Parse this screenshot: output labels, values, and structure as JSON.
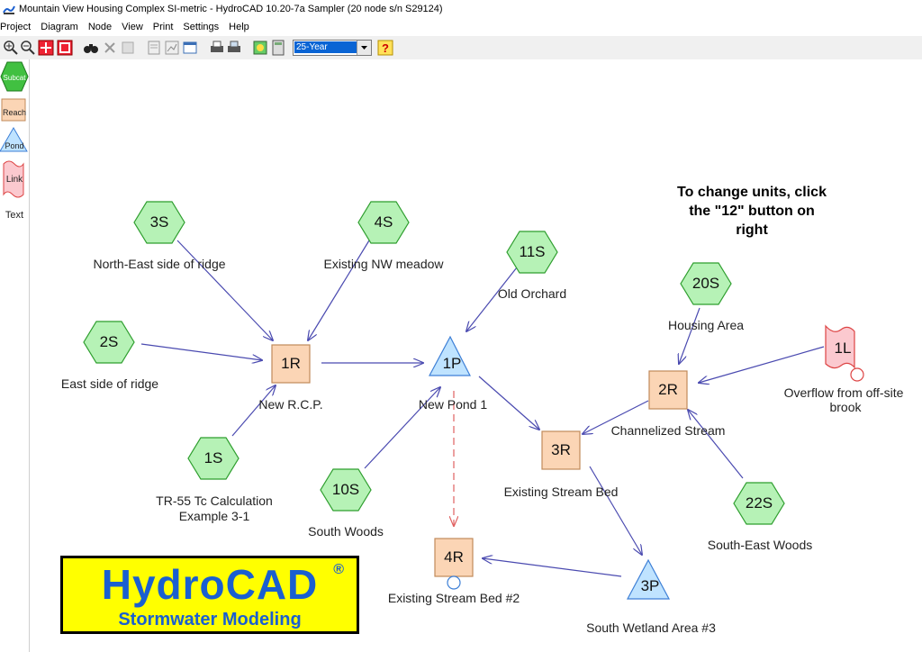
{
  "window": {
    "title": "Mountain View Housing Complex SI-metric - HydroCAD 10.20-7a Sampler (20 node s/n S29124)"
  },
  "menu": [
    "Project",
    "Diagram",
    "Node",
    "View",
    "Print",
    "Settings",
    "Help"
  ],
  "toolbar": {
    "storm_select": "25-Year",
    "help_button": "?"
  },
  "palette": {
    "subcat": "Subcat",
    "reach": "Reach",
    "pond": "Pond",
    "link": "Link",
    "text": "Text"
  },
  "nodes": {
    "n3S": {
      "id": "3S",
      "label": "North-East side of ridge"
    },
    "n4S": {
      "id": "4S",
      "label": "Existing NW meadow"
    },
    "n11S": {
      "id": "11S",
      "label": "Old Orchard"
    },
    "n20S": {
      "id": "20S",
      "label": "Housing Area"
    },
    "n2S": {
      "id": "2S",
      "label": "East side of ridge"
    },
    "n1R": {
      "id": "1R",
      "label": "New R.C.P."
    },
    "n1P": {
      "id": "1P",
      "label": "New Pond 1"
    },
    "n1L": {
      "id": "1L",
      "label_1": "Overflow from off-site",
      "label_2": "brook"
    },
    "n2R": {
      "id": "2R",
      "label": "Channelized Stream"
    },
    "n1S": {
      "id": "1S",
      "label_1": "TR-55 Tc Calculation",
      "label_2": "Example 3-1"
    },
    "n10S": {
      "id": "10S",
      "label": "South Woods"
    },
    "n3R": {
      "id": "3R",
      "label": "Existing Stream Bed"
    },
    "n22S": {
      "id": "22S",
      "label": "South-East Woods"
    },
    "n4R": {
      "id": "4R",
      "label": "Existing Stream Bed #2"
    },
    "n3P": {
      "id": "3P",
      "label": "South Wetland Area #3"
    }
  },
  "note": {
    "line1": "To change units, click",
    "line2": "the \"12\" button on",
    "line3": "right"
  },
  "logo": {
    "title": "HydroCAD",
    "reg": "®",
    "subtitle": "Stormwater Modeling"
  },
  "colors": {
    "subcat_fill": "#b6f2b6",
    "subcat_stroke": "#2e9e2e",
    "reach_fill": "#fbd5b5",
    "reach_stroke": "#c08a5a",
    "pond_fill": "#bfe3ff",
    "pond_stroke": "#3d7fd6",
    "link_fill": "#fbc9cf",
    "link_stroke": "#d44",
    "arrow": "#4a4ab0",
    "logo_bg": "#ffff00",
    "logo_text": "#1a5fd0"
  }
}
